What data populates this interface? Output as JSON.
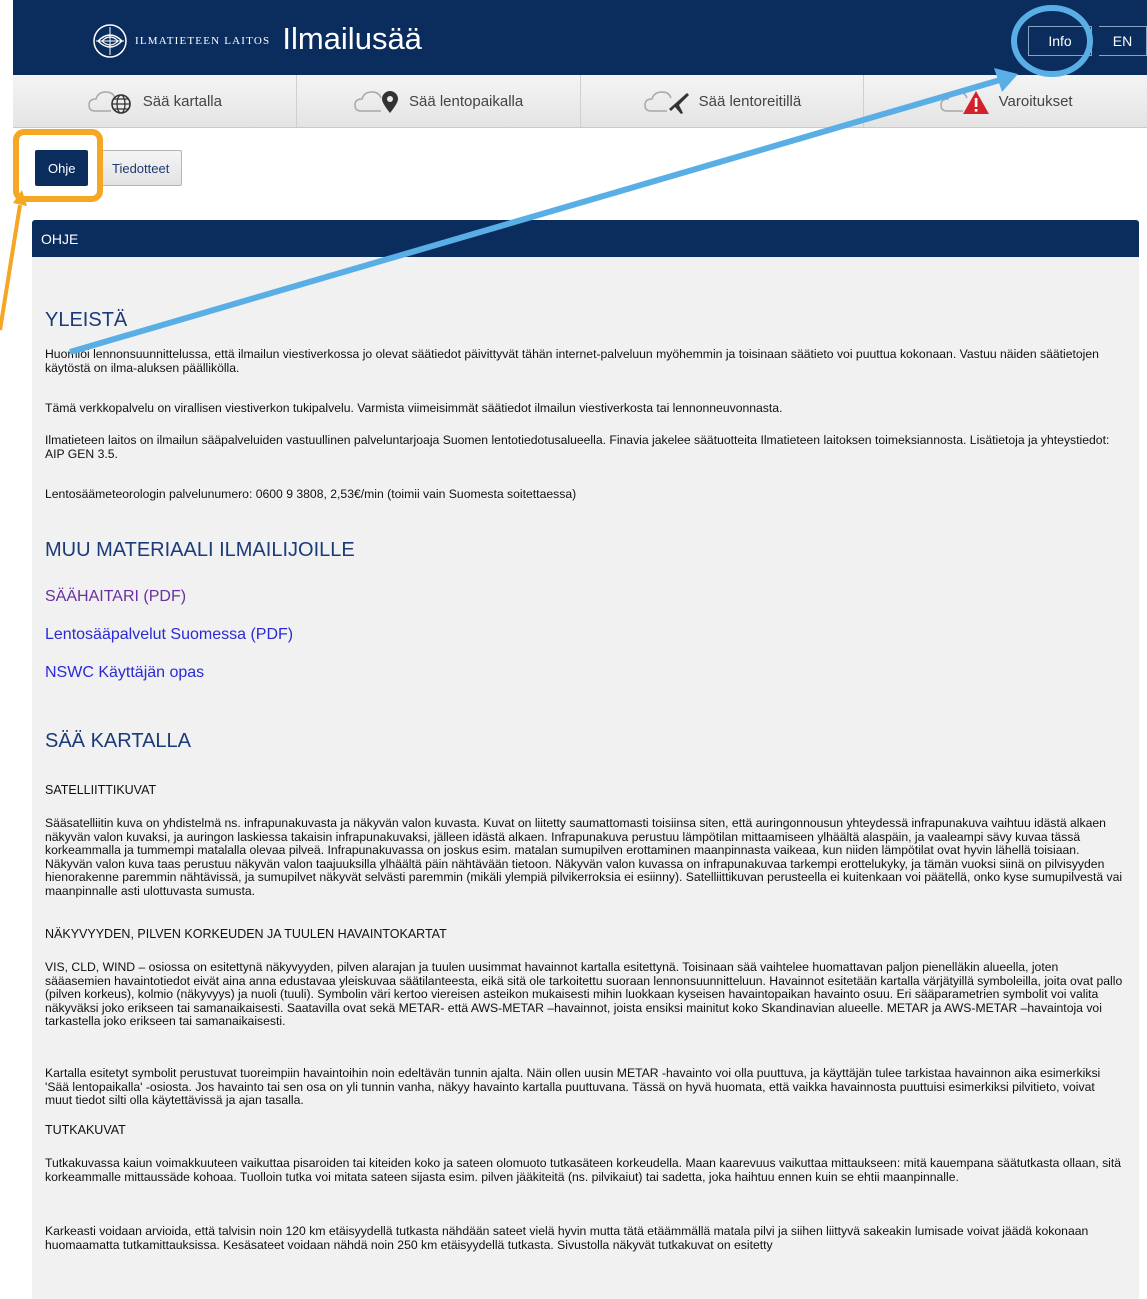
{
  "header": {
    "org_name": "ILMATIETEEN LAITOS",
    "app_title": "Ilmailusää",
    "info_label": "Info",
    "lang_label": "EN"
  },
  "nav": {
    "items": [
      {
        "label": "Sää kartalla",
        "icon": "cloud-globe-icon"
      },
      {
        "label": "Sää lentopaikalla",
        "icon": "cloud-location-icon"
      },
      {
        "label": "Sää lentoreitillä",
        "icon": "cloud-plane-icon"
      },
      {
        "label": "Varoitukset",
        "icon": "cloud-warning-icon"
      }
    ]
  },
  "subtabs": {
    "active": "Ohje",
    "inactive": "Tiedotteet"
  },
  "panel": {
    "title": "OHJE"
  },
  "content": {
    "yleista_title": "YLEISTÄ",
    "p1": "Huomioi lennonsuunnittelussa, että ilmailun viestiverkossa jo olevat säätiedot päivittyvät tähän internet-palveluun myöhemmin ja toisinaan säätieto voi puuttua kokonaan. Vastuu näiden säätietojen käytöstä on ilma-aluksen päällikölla.",
    "p2": "Tämä verkkopalvelu on virallisen viestiverkon tukipalvelu. Varmista viimeisimmät säätiedot ilmailun viestiverkosta tai lennonneuvonnasta.",
    "p3": "Ilmatieteen laitos on ilmailun sääpalveluiden vastuullinen palveluntarjoaja Suomen lentotiedotusalueella. Finavia jakelee säätuotteita Ilmatieteen laitoksen toimeksiannosta. Lisätietoja ja yhteystiedot: AIP GEN 3.5.",
    "p4": "Lentosäämeteorologin palvelunumero: 0600 9 3808, 2,53€/min (toimii vain Suomesta soitettaessa)",
    "muu_title": "MUU MATERIAALI ILMAILIJOILLE",
    "link1": "SÄÄHAITARI (PDF)",
    "link2": "Lentosääpalvelut Suomessa (PDF)",
    "link3": "NSWC Käyttäjän opas",
    "saa_title": "SÄÄ KARTALLA",
    "sat_head": "SATELLIITTIKUVAT",
    "sat_para": "Sääsatelliitin kuva on yhdistelmä ns. infrapunakuvasta ja näkyvän valon kuvasta. Kuvat on liitetty saumattomasti toisiinsa siten, että auringonnousun yhteydessä infrapunakuva vaihtuu idästä alkaen näkyvän valon kuvaksi, ja auringon laskiessa takaisin infrapunakuvaksi, jälleen idästä alkaen. Infrapunakuva perustuu lämpötilan mittaamiseen ylhäältä alaspäin, ja vaaleampi sävy kuvaa tässä korkeammalla ja tummempi matalalla olevaa pilveä. Infrapunakuvassa on joskus esim. matalan sumupilven erottaminen maanpinnasta vaikeaa, kun niiden lämpötilat ovat hyvin lähellä toisiaan. Näkyvän valon kuva taas perustuu näkyvän valon taajuuksilla ylhäältä päin nähtävään tietoon. Näkyvän valon kuvassa on infrapunakuvaa tarkempi erottelukyky, ja tämän vuoksi siinä on pilvisyyden hienorakenne paremmin nähtävissä, ja sumupilvet näkyvät selvästi paremmin (mikäli ylempiä pilvikerroksia ei esiinny). Satelliittikuvan perusteella ei kuitenkaan voi päätellä, onko kyse sumupilvestä vai maanpinnalle asti ulottuvasta sumusta.",
    "nak_head": "NÄKYVYYDEN, PILVEN KORKEUDEN JA TUULEN HAVAINTOKARTAT",
    "nak_para1": "VIS, CLD, WIND – osiossa on esitettynä näkyvyyden, pilven alarajan ja tuulen uusimmat havainnot kartalla esitettynä. Toisinaan sää vaihtelee huomattavan paljon pienelläkin alueella, joten sääasemien havaintotiedot eivät aina anna edustavaa yleiskuvaa säätilanteesta, eikä sitä ole tarkoitettu suoraan lennonsuunnitteluun. Havainnot esitetään kartalla värjätyillä symboleilla, joita ovat pallo (pilven korkeus), kolmio (näkyvyys) ja nuoli (tuuli). Symbolin väri kertoo viereisen asteikon mukaisesti mihin luokkaan kyseisen havaintopaikan havainto osuu. Eri sääparametrien symbolit voi valita näkyväksi joko erikseen tai samanaikaisesti. Saatavilla ovat sekä METAR- että AWS-METAR –havainnot, joista ensiksi mainitut koko Skandinavian alueelle. METAR ja AWS-METAR –havaintoja voi tarkastella joko erikseen tai samanaikaisesti.",
    "nak_para2": "Kartalla esitetyt symbolit perustuvat tuoreimpiin havaintoihin noin edeltävän tunnin ajalta. Näin ollen uusin METAR -havainto voi olla puuttuva, ja käyttäjän tulee tarkistaa havainnon aika esimerkiksi 'Sää lentopaikalla' -osiosta. Jos havainto tai sen osa on yli tunnin vanha, näkyy havainto kartalla puuttuvana. Tässä on hyvä huomata, että vaikka havainnosta puuttuisi esimerkiksi pilvitieto, voivat muut tiedot silti olla käytettävissä ja ajan tasalla.",
    "tutka_head": "TUTKAKUVAT",
    "tutka_para1": "Tutkakuvassa kaiun voimakkuuteen vaikuttaa pisaroiden tai kiteiden koko ja sateen olomuoto tutkasäteen korkeudella. Maan kaarevuus vaikuttaa mittaukseen: mitä kauempana säätutkasta ollaan, sitä korkeammalle mittaussäde kohoaa. Tuolloin tutka voi mitata sateen sijasta esim. pilven jääkiteitä (ns. pilvikaiut) tai sadetta, joka haihtuu ennen kuin se ehtii maanpinnalle.",
    "tutka_para2": "Karkeasti voidaan arvioida, että talvisin noin 120 km etäisyydellä tutkasta nähdään sateet vielä hyvin mutta tätä etäämmällä matala pilvi ja siihen liittyvä sakeakin lumisade voivat jäädä kokonaan huomaamatta tutkamittauksissa. Kesäsateet voidaan nähdä noin 250 km etäisyydellä tutkasta. Sivustolla näkyvät tutkakuvat on esitetty"
  },
  "colors": {
    "navy": "#0b2d5e",
    "annotation_blue": "#5aaee6",
    "annotation_orange": "#f5a623",
    "warning_red": "#d4202a"
  }
}
